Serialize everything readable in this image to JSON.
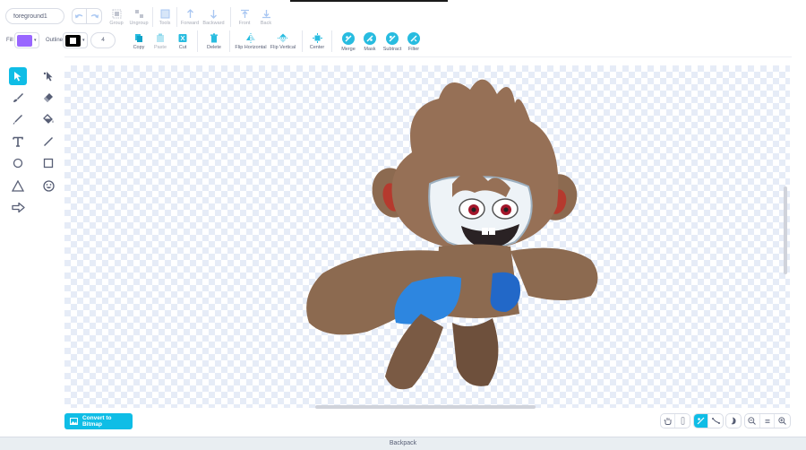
{
  "costume_name": "foreground1",
  "toolbar": {
    "group": "Group",
    "ungroup": "Ungroup",
    "tools": "Tools",
    "forward": "Forward",
    "backward": "Backward",
    "front": "Front",
    "back": "Back",
    "copy": "Copy",
    "paste": "Paste",
    "cut": "Cut",
    "delete": "Delete",
    "flip_horizontal": "Flip Horizontal",
    "flip_vertical": "Flip Vertical",
    "center": "Center",
    "merge": "Merge",
    "mask": "Mask",
    "subtract": "Subtract",
    "filter": "Filter"
  },
  "fill": {
    "label": "Fill",
    "color": "#9966ff"
  },
  "outline": {
    "label": "Outline",
    "color": "#000000",
    "width": "4"
  },
  "tools": [
    "select",
    "reshape",
    "brush",
    "eraser",
    "pen",
    "fill",
    "text",
    "line",
    "circle",
    "rectangle",
    "triangle",
    "emoji",
    "arrow"
  ],
  "active_tool": "select",
  "convert_button": "Convert to Bitmap",
  "backpack": "Backpack",
  "colors": {
    "accent": "#0fbde6",
    "text": "#575e75"
  }
}
